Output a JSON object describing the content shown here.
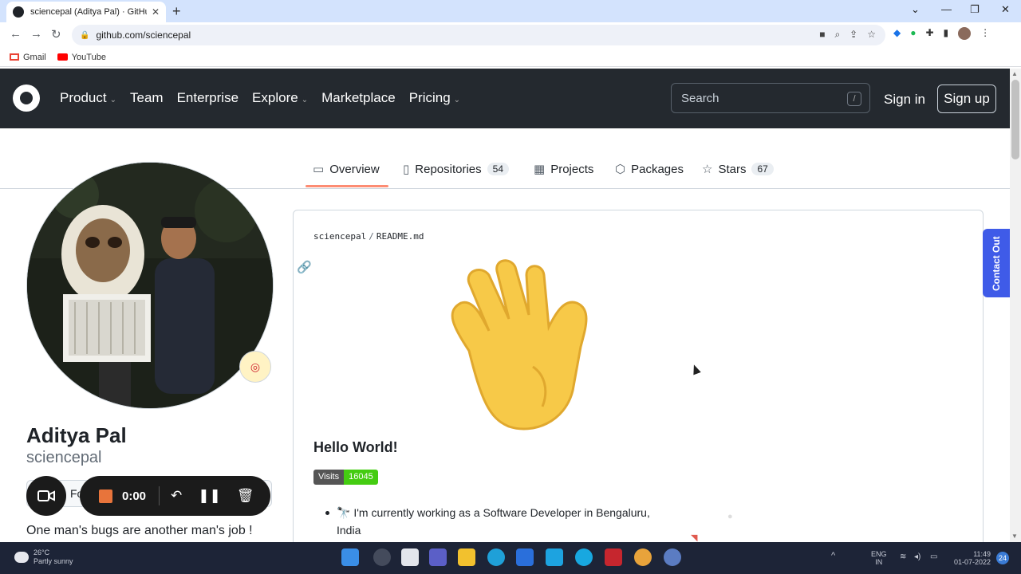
{
  "browser": {
    "tab_title": "sciencepal (Aditya Pal) · GitHub",
    "tab_close": "✕",
    "new_tab": "+",
    "url": "github.com/sciencepal",
    "bookmarks": [
      {
        "label": "Gmail"
      },
      {
        "label": "YouTube"
      }
    ],
    "window_controls": [
      "⌄",
      "—",
      "❐",
      "✕"
    ]
  },
  "gh_header": {
    "nav": [
      {
        "label": "Product",
        "dropdown": true
      },
      {
        "label": "Team",
        "dropdown": false
      },
      {
        "label": "Enterprise",
        "dropdown": false
      },
      {
        "label": "Explore",
        "dropdown": true
      },
      {
        "label": "Marketplace",
        "dropdown": false
      },
      {
        "label": "Pricing",
        "dropdown": true
      }
    ],
    "search_placeholder": "Search",
    "search_shortcut": "/",
    "signin_label": "Sign in",
    "signup_label": "Sign up"
  },
  "profile_tabs": [
    {
      "label": "Overview",
      "icon": "book-icon",
      "count": ""
    },
    {
      "label": "Repositories",
      "icon": "repo-icon",
      "count": "54"
    },
    {
      "label": "Projects",
      "icon": "table-icon",
      "count": ""
    },
    {
      "label": "Packages",
      "icon": "package-icon",
      "count": ""
    },
    {
      "label": "Stars",
      "icon": "star-icon",
      "count": "67"
    }
  ],
  "sidebar": {
    "name": "Aditya Pal",
    "username": "sciencepal",
    "follow_label": "Follow",
    "bio": "One man's bugs are another man's job !",
    "status_icon": "target-icon"
  },
  "recorder": {
    "time": "0:00"
  },
  "readme": {
    "owner": "sciencepal",
    "separator": "/",
    "file": "README.md",
    "heading": "Hello World!",
    "visits_label": "Visits",
    "visits_count": "16045",
    "bullets": [
      {
        "emoji": "🔭",
        "text": "I'm currently working as a Software Developer in Bengaluru, India"
      }
    ]
  },
  "contact_out": "Contact Out",
  "taskbar": {
    "weather_temp": "26°C",
    "weather_desc": "Partly sunny",
    "lang_line1": "ENG",
    "lang_line2": "IN",
    "time": "11:49",
    "date": "01-07-2022",
    "notifications": "24"
  },
  "colors": {
    "gh_header_bg": "#24292f",
    "tab_underline": "#fd8c73",
    "contact_out_bg": "#3f5be8",
    "visits_badge": "#44cc11",
    "taskbar_bg": "#1d2437"
  }
}
